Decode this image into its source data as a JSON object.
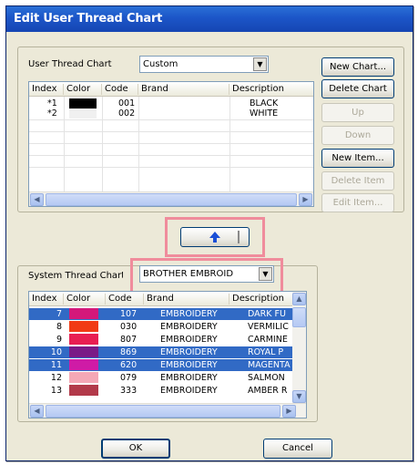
{
  "window": {
    "title": "Edit User Thread Chart"
  },
  "user_chart": {
    "label": "User Thread Chart",
    "selected": "Custom",
    "columns": [
      "Index",
      "Color",
      "Code",
      "Brand",
      "Description"
    ],
    "rows": [
      {
        "index": "*1",
        "color": "#000000",
        "code": "001",
        "brand": "",
        "description": "BLACK"
      },
      {
        "index": "*2",
        "color": "#f0f0f0",
        "code": "002",
        "brand": "",
        "description": "WHITE"
      }
    ]
  },
  "buttons": {
    "new_chart": "New Chart...",
    "delete_chart": "Delete Chart",
    "up": "Up",
    "down": "Down",
    "new_item": "New Item...",
    "delete_item": "Delete Item",
    "edit_item": "Edit Item...",
    "ok": "OK",
    "cancel": "Cancel"
  },
  "system_chart": {
    "label": "System Thread Chart",
    "selected": "BROTHER EMBROID",
    "columns": [
      "Index",
      "Color",
      "Code",
      "Brand",
      "Description"
    ],
    "rows": [
      {
        "index": "7",
        "color": "#d4187a",
        "code": "107",
        "brand": "EMBROIDERY",
        "description": "DARK FU",
        "selected": true
      },
      {
        "index": "8",
        "color": "#f13a14",
        "code": "030",
        "brand": "EMBROIDERY",
        "description": "VERMILIC",
        "selected": false
      },
      {
        "index": "9",
        "color": "#e81e52",
        "code": "807",
        "brand": "EMBROIDERY",
        "description": "CARMINE",
        "selected": false
      },
      {
        "index": "10",
        "color": "#7a1a86",
        "code": "869",
        "brand": "EMBROIDERY",
        "description": "ROYAL P",
        "selected": true
      },
      {
        "index": "11",
        "color": "#cf1ba6",
        "code": "620",
        "brand": "EMBROIDERY",
        "description": "MAGENTA",
        "selected": true
      },
      {
        "index": "12",
        "color": "#f4a8b6",
        "code": "079",
        "brand": "EMBROIDERY",
        "description": "SALMON",
        "selected": false
      },
      {
        "index": "13",
        "color": "#b23a4a",
        "code": "333",
        "brand": "EMBROIDERY",
        "description": "AMBER R",
        "selected": false
      }
    ]
  },
  "colors": {
    "selection": "#316ac5",
    "highlight": "#f08c9c",
    "title_bar": "#1c55c8",
    "arrow": "#1a4fd6"
  }
}
